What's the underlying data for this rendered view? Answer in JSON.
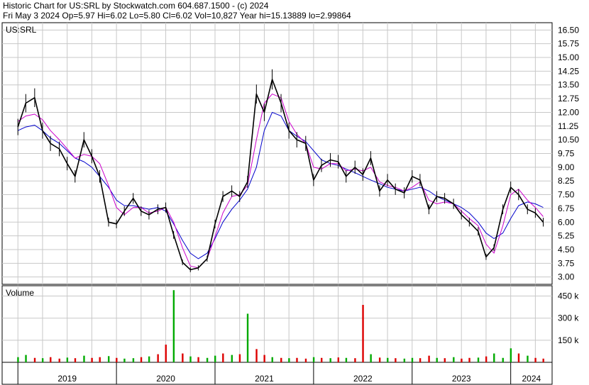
{
  "header": {
    "line1": "Historic Chart for US:SRL by Stockwatch.com 604.687.1500 - (c) 2024",
    "line2": "Fri May  3 2024  Op=5.97  Hi=6.02  Lo=5.80  Cl=6.02  Vol=10,827  Year hi=15.13889  lo=2.99864"
  },
  "colors": {
    "price_bars": "#000000",
    "ma_short": "#cc00cc",
    "ma_long": "#0000cc",
    "vol_up": "#00aa00",
    "vol_down": "#dd0000",
    "grid": "#c8c8c8"
  },
  "chart_data": [
    {
      "type": "line",
      "title": "US:SRL",
      "ylim": [
        2.6,
        16.9
      ],
      "y_ticks": [
        "16.50",
        "15.75",
        "15.00",
        "14.25",
        "13.50",
        "12.75",
        "12.00",
        "11.25",
        "10.50",
        "9.75",
        "9.00",
        "8.25",
        "7.50",
        "6.75",
        "6.00",
        "5.25",
        "4.50",
        "3.75",
        "3.00"
      ],
      "x_ticks": [
        "2019",
        "2020",
        "2021",
        "2022",
        "2023",
        "2024"
      ],
      "x": [
        2019.0,
        2019.08,
        2019.17,
        2019.25,
        2019.33,
        2019.42,
        2019.5,
        2019.58,
        2019.67,
        2019.75,
        2019.83,
        2019.92,
        2020.0,
        2020.08,
        2020.17,
        2020.25,
        2020.33,
        2020.42,
        2020.5,
        2020.58,
        2020.67,
        2020.75,
        2020.83,
        2020.92,
        2021.0,
        2021.08,
        2021.17,
        2021.25,
        2021.33,
        2021.42,
        2021.5,
        2021.58,
        2021.67,
        2021.75,
        2021.83,
        2021.92,
        2022.0,
        2022.08,
        2022.17,
        2022.25,
        2022.33,
        2022.42,
        2022.5,
        2022.58,
        2022.67,
        2022.75,
        2022.83,
        2022.92,
        2023.0,
        2023.08,
        2023.17,
        2023.25,
        2023.33,
        2023.42,
        2023.5,
        2023.58,
        2023.67,
        2023.75,
        2023.83,
        2023.92,
        2024.0,
        2024.08,
        2024.17,
        2024.25,
        2024.33
      ],
      "series": [
        {
          "values": [
            11.2,
            12.5,
            12.8,
            11.0,
            10.3,
            10.0,
            9.2,
            8.5,
            10.5,
            9.6,
            8.5,
            6.0,
            5.9,
            6.6,
            7.3,
            6.6,
            6.4,
            6.7,
            6.8,
            5.3,
            3.8,
            3.4,
            3.5,
            4.0,
            5.9,
            7.4,
            7.7,
            7.4,
            8.2,
            13.0,
            12.0,
            13.8,
            12.5,
            11.0,
            10.5,
            10.3,
            8.3,
            9.1,
            9.4,
            9.3,
            8.5,
            9.0,
            8.6,
            9.5,
            7.7,
            8.3,
            7.8,
            7.6,
            8.5,
            8.3,
            6.7,
            7.4,
            7.3,
            7.0,
            6.4,
            6.0,
            5.5,
            4.1,
            4.6,
            6.7,
            7.9,
            7.5,
            6.7,
            6.5,
            6.0
          ]
        },
        {
          "values": [
            11.5,
            11.8,
            11.9,
            11.6,
            11.0,
            10.5,
            10.0,
            9.5,
            9.7,
            9.6,
            9.2,
            8.0,
            6.8,
            6.4,
            6.8,
            6.8,
            6.5,
            6.6,
            6.8,
            6.0,
            4.6,
            3.6,
            3.5,
            4.0,
            5.2,
            6.5,
            7.4,
            7.5,
            8.0,
            10.5,
            12.5,
            13.0,
            12.8,
            11.5,
            10.8,
            10.3,
            9.0,
            8.9,
            9.2,
            9.2,
            8.8,
            8.9,
            8.8,
            9.0,
            8.2,
            8.0,
            7.9,
            7.7,
            7.9,
            8.2,
            7.2,
            7.0,
            7.1,
            7.0,
            6.6,
            6.2,
            5.8,
            4.8,
            4.3,
            5.8,
            7.5,
            7.8,
            7.2,
            6.8,
            6.3
          ]
        },
        {
          "values": [
            11.0,
            11.2,
            11.3,
            11.0,
            10.6,
            10.3,
            9.9,
            9.5,
            9.3,
            9.0,
            8.5,
            7.9,
            7.2,
            6.9,
            6.9,
            6.8,
            6.7,
            6.8,
            6.6,
            5.9,
            5.0,
            4.3,
            4.0,
            4.3,
            5.1,
            6.0,
            6.7,
            7.2,
            7.8,
            9.0,
            11.0,
            12.0,
            11.8,
            11.0,
            10.7,
            10.4,
            9.9,
            9.4,
            9.2,
            9.1,
            8.9,
            8.7,
            8.5,
            8.3,
            8.1,
            7.9,
            7.8,
            7.7,
            7.8,
            7.9,
            7.7,
            7.4,
            7.2,
            7.0,
            6.8,
            6.5,
            6.0,
            5.4,
            5.1,
            5.4,
            6.2,
            6.9,
            7.1,
            7.0,
            6.8
          ]
        }
      ]
    },
    {
      "type": "bar",
      "title": "Volume",
      "ylim": [
        0,
        520000
      ],
      "y_ticks": [
        "450 k",
        "300 k",
        "150 k"
      ],
      "x": [
        2019.0,
        2019.08,
        2019.17,
        2019.25,
        2019.33,
        2019.42,
        2019.5,
        2019.58,
        2019.67,
        2019.75,
        2019.83,
        2019.92,
        2020.0,
        2020.08,
        2020.17,
        2020.25,
        2020.33,
        2020.42,
        2020.5,
        2020.58,
        2020.67,
        2020.75,
        2020.83,
        2020.92,
        2021.0,
        2021.08,
        2021.17,
        2021.25,
        2021.33,
        2021.42,
        2021.5,
        2021.58,
        2021.67,
        2021.75,
        2021.83,
        2021.92,
        2022.0,
        2022.08,
        2022.17,
        2022.25,
        2022.33,
        2022.42,
        2022.5,
        2022.58,
        2022.67,
        2022.75,
        2022.83,
        2022.92,
        2023.0,
        2023.08,
        2023.17,
        2023.25,
        2023.33,
        2023.42,
        2023.5,
        2023.58,
        2023.67,
        2023.75,
        2023.83,
        2023.92,
        2024.0,
        2024.08,
        2024.17,
        2024.25,
        2024.33
      ],
      "values": [
        35000,
        50000,
        30000,
        28000,
        35000,
        25000,
        32000,
        28000,
        45000,
        30000,
        35000,
        42000,
        30000,
        25000,
        28000,
        35000,
        40000,
        55000,
        120000,
        490000,
        60000,
        40000,
        35000,
        30000,
        45000,
        60000,
        50000,
        55000,
        330000,
        90000,
        50000,
        35000,
        30000,
        28000,
        30000,
        25000,
        35000,
        30000,
        28000,
        33000,
        30000,
        28000,
        390000,
        55000,
        32000,
        30000,
        28000,
        25000,
        30000,
        28000,
        45000,
        30000,
        28000,
        35000,
        25000,
        30000,
        32000,
        40000,
        60000,
        30000,
        95000,
        60000,
        45000,
        30000,
        25000
      ],
      "direction": [
        "up",
        "up",
        "down",
        "up",
        "down",
        "down",
        "up",
        "down",
        "up",
        "down",
        "down",
        "up",
        "down",
        "up",
        "up",
        "down",
        "up",
        "down",
        "down",
        "up",
        "down",
        "up",
        "down",
        "up",
        "up",
        "down",
        "up",
        "down",
        "up",
        "down",
        "down",
        "up",
        "down",
        "up",
        "down",
        "down",
        "up",
        "down",
        "up",
        "down",
        "up",
        "down",
        "down",
        "up",
        "down",
        "up",
        "down",
        "up",
        "up",
        "down",
        "down",
        "up",
        "down",
        "up",
        "down",
        "down",
        "up",
        "down",
        "up",
        "up",
        "up",
        "down",
        "up",
        "down",
        "down"
      ]
    }
  ]
}
